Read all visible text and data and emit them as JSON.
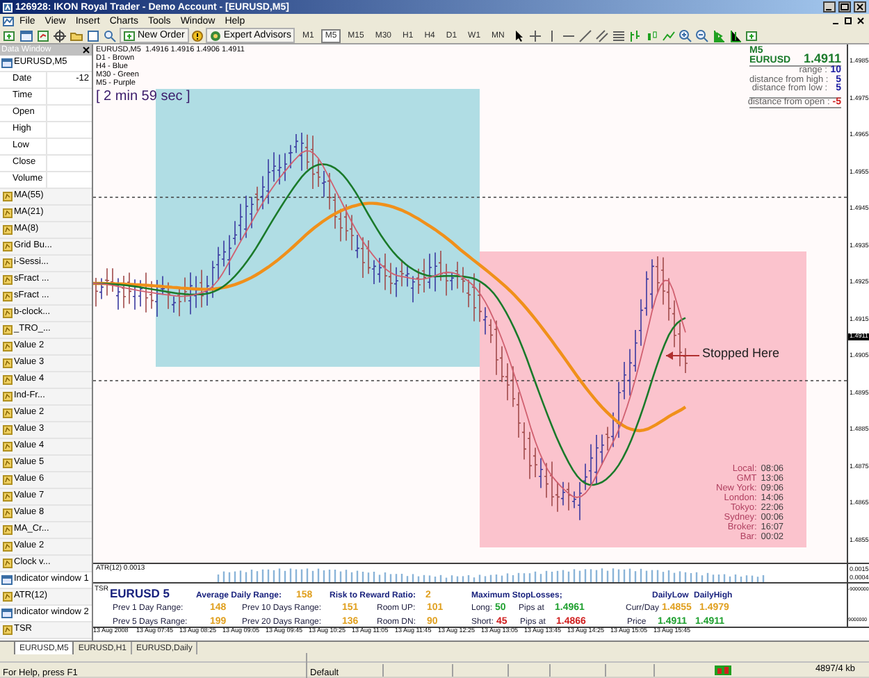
{
  "window": {
    "title": "126928: IKON Royal Trader - Demo Account - [EURUSD,M5]"
  },
  "menu": [
    "File",
    "View",
    "Insert",
    "Charts",
    "Tools",
    "Window",
    "Help"
  ],
  "toolbar": {
    "buttons": [
      "New Order",
      "Expert Advisors"
    ],
    "timeframes": [
      {
        "label": "M1",
        "selected": false
      },
      {
        "label": "M5",
        "selected": true
      },
      {
        "label": "M15",
        "selected": false
      },
      {
        "label": "M30",
        "selected": false
      },
      {
        "label": "H1",
        "selected": false
      },
      {
        "label": "H4",
        "selected": false
      },
      {
        "label": "D1",
        "selected": false
      },
      {
        "label": "W1",
        "selected": false
      },
      {
        "label": "MN",
        "selected": false
      }
    ]
  },
  "data_window": {
    "title": "Data Window",
    "rows": [
      {
        "kind": "symbol",
        "label": "EURUSD,M5"
      },
      {
        "kind": "field",
        "label": "Date",
        "value": "-12"
      },
      {
        "kind": "field",
        "label": "Time"
      },
      {
        "kind": "field",
        "label": "Open"
      },
      {
        "kind": "field",
        "label": "High"
      },
      {
        "kind": "field",
        "label": "Low"
      },
      {
        "kind": "field",
        "label": "Close"
      },
      {
        "kind": "field",
        "label": "Volume"
      },
      {
        "kind": "indicator",
        "label": "MA(55)"
      },
      {
        "kind": "indicator",
        "label": "MA(21)"
      },
      {
        "kind": "indicator",
        "label": "MA(8)"
      },
      {
        "kind": "indicator",
        "label": "Grid Bu..."
      },
      {
        "kind": "indicator",
        "label": "i-Sessi..."
      },
      {
        "kind": "indicator",
        "label": "sFract ..."
      },
      {
        "kind": "indicator",
        "label": "sFract ..."
      },
      {
        "kind": "indicator",
        "label": "b-clock..."
      },
      {
        "kind": "indicator",
        "label": "_TRO_..."
      },
      {
        "kind": "indicator",
        "label": "Value 2"
      },
      {
        "kind": "indicator",
        "label": "Value 3"
      },
      {
        "kind": "indicator",
        "label": "Value 4"
      },
      {
        "kind": "indicator",
        "label": "Ind-Fr..."
      },
      {
        "kind": "indicator",
        "label": "Value 2"
      },
      {
        "kind": "indicator",
        "label": "Value 3"
      },
      {
        "kind": "indicator",
        "label": "Value 4"
      },
      {
        "kind": "indicator",
        "label": "Value 5"
      },
      {
        "kind": "indicator",
        "label": "Value 6"
      },
      {
        "kind": "indicator",
        "label": "Value 7"
      },
      {
        "kind": "indicator",
        "label": "Value 8"
      },
      {
        "kind": "indicator",
        "label": "MA_Cr..."
      },
      {
        "kind": "indicator",
        "label": "Value 2"
      },
      {
        "kind": "indicator",
        "label": "Clock v..."
      },
      {
        "kind": "window",
        "label": "Indicator window 1"
      },
      {
        "kind": "indicator",
        "label": "ATR(12)"
      },
      {
        "kind": "window",
        "label": "Indicator window 2"
      },
      {
        "kind": "indicator",
        "label": "TSR"
      }
    ]
  },
  "chart": {
    "header": "EURUSD,M5  1.4916 1.4916 1.4906 1.4911",
    "legend": [
      "D1 - Brown",
      "H4 - Blue",
      "M30 - Green",
      "M5 - Purple"
    ],
    "timer": "[ 2 min 59 sec ]",
    "info": {
      "title": "M5 EURUSD",
      "price": "1.4911",
      "rows": [
        {
          "label": "range :",
          "value": "10",
          "color": "#1a1aa0"
        },
        {
          "label": "distance from high :",
          "value": "5",
          "color": "#1a1aa0"
        },
        {
          "label": "distance from low :",
          "value": "5",
          "color": "#1a1aa0"
        },
        {
          "label": "distance from open :",
          "value": "-5",
          "color": "#d02020"
        }
      ]
    },
    "annotation": "Stopped Here",
    "clock": [
      {
        "label": "Local:",
        "value": "08:06"
      },
      {
        "label": "GMT",
        "value": "13:06"
      },
      {
        "label": "New York:",
        "value": "09:06"
      },
      {
        "label": "London:",
        "value": "14:06"
      },
      {
        "label": "Tokyo:",
        "value": "22:06"
      },
      {
        "label": "Sydney:",
        "value": "00:06"
      },
      {
        "label": "Broker:",
        "value": "16:07"
      },
      {
        "label": "Bar:",
        "value": "00:02"
      }
    ],
    "price_axis": [
      "1.4985",
      "1.4975",
      "1.4965",
      "1.4955",
      "1.4945",
      "1.4935",
      "1.4925",
      "1.4915",
      "1.4905",
      "1.4895",
      "1.4885",
      "1.4875",
      "1.4865",
      "1.4855"
    ],
    "current_price": "1.4911"
  },
  "atr": {
    "label": "ATR(12) 0.0013",
    "axis": [
      "0.0015",
      "0.0004"
    ]
  },
  "tsr": {
    "label": "TSR",
    "header": [
      {
        "text": "EURUSD 5",
        "kind": "title"
      },
      {
        "text": "Average Daily Range:",
        "kind": "heading"
      },
      {
        "text": "158",
        "kind": "value"
      },
      {
        "text": "Risk to Reward Ratio:",
        "kind": "heading"
      },
      {
        "text": "2",
        "kind": "value"
      },
      {
        "text": "Maximum StopLosses;",
        "kind": "heading"
      },
      {
        "text": "DailyLow",
        "kind": "heading"
      },
      {
        "text": "DailyHigh",
        "kind": "heading"
      }
    ],
    "line_1": [
      {
        "text": "Prev 1 Day Range:",
        "kind": "label"
      },
      {
        "text": "148",
        "kind": "value"
      },
      {
        "text": "Prev 10 Days Range:",
        "kind": "label"
      },
      {
        "text": "151",
        "kind": "value"
      },
      {
        "text": "Room UP:",
        "kind": "label"
      },
      {
        "text": "101",
        "kind": "value"
      },
      {
        "text": "Long:",
        "kind": "label"
      },
      {
        "text": "50",
        "kind": "up"
      },
      {
        "text": "Pips at",
        "kind": "label"
      },
      {
        "text": "1.4961",
        "kind": "up"
      },
      {
        "text": "Curr/Day",
        "kind": "label"
      },
      {
        "text": "1.4855",
        "kind": "value"
      },
      {
        "text": "1.4979",
        "kind": "value"
      }
    ],
    "line_2": [
      {
        "text": "Prev 5 Days Range:",
        "kind": "label"
      },
      {
        "text": "199",
        "kind": "value"
      },
      {
        "text": "Prev 20 Days Range:",
        "kind": "label"
      },
      {
        "text": "136",
        "kind": "value"
      },
      {
        "text": "Room DN:",
        "kind": "label"
      },
      {
        "text": "90",
        "kind": "value"
      },
      {
        "text": "Short:",
        "kind": "label"
      },
      {
        "text": "45",
        "kind": "down"
      },
      {
        "text": "Pips at",
        "kind": "label"
      },
      {
        "text": "1.4866",
        "kind": "down"
      },
      {
        "text": "Price",
        "kind": "label"
      },
      {
        "text": "1.4911",
        "kind": "up"
      },
      {
        "text": "1.4911",
        "kind": "up"
      }
    ],
    "axis": [
      "-9000000",
      "9000000"
    ]
  },
  "time_axis": [
    "13 Aug 2008",
    "13 Aug 07:45",
    "13 Aug 08:25",
    "13 Aug 09:05",
    "13 Aug 09:45",
    "13 Aug 10:25",
    "13 Aug 11:05",
    "13 Aug 11:45",
    "13 Aug 12:25",
    "13 Aug 13:05",
    "13 Aug 13:45",
    "13 Aug 14:25",
    "13 Aug 15:05",
    "13 Aug 15:45"
  ],
  "tabs": [
    {
      "label": "EURUSD,M5",
      "selected": true
    },
    {
      "label": "EURUSD,H1",
      "selected": false
    },
    {
      "label": "EURUSD,Daily",
      "selected": false
    }
  ],
  "status_bar": {
    "help": "For Help, press F1",
    "profile": "Default",
    "traffic": "4897/4 kb"
  }
}
